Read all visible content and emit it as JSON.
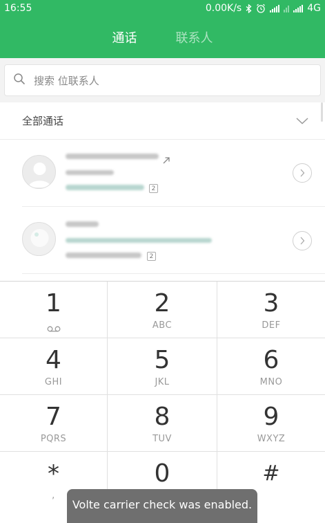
{
  "status_bar": {
    "time": "16:55",
    "network_speed": "0.00K/s",
    "network_type": "4G",
    "icons": [
      "bluetooth-icon",
      "alarm-icon",
      "signal-icon",
      "signal-icon",
      "signal-icon"
    ]
  },
  "tabs": [
    {
      "label": "通话",
      "active": true
    },
    {
      "label": "联系人",
      "active": false
    }
  ],
  "search": {
    "placeholder": "搜索   位联系人"
  },
  "section": {
    "title": "全部通话"
  },
  "calls": [
    {
      "count": "2",
      "call_direction_icon": "outgoing-arrow-icon"
    },
    {
      "count": "2"
    }
  ],
  "dialpad": {
    "keys": [
      {
        "digit": "1",
        "letters": "",
        "icon": "voicemail-icon"
      },
      {
        "digit": "2",
        "letters": "ABC"
      },
      {
        "digit": "3",
        "letters": "DEF"
      },
      {
        "digit": "4",
        "letters": "GHI"
      },
      {
        "digit": "5",
        "letters": "JKL"
      },
      {
        "digit": "6",
        "letters": "MNO"
      },
      {
        "digit": "7",
        "letters": "PQRS"
      },
      {
        "digit": "8",
        "letters": "TUV"
      },
      {
        "digit": "9",
        "letters": "WXYZ"
      },
      {
        "digit": "*",
        "letters": ","
      },
      {
        "digit": "0",
        "letters": "+"
      },
      {
        "digit": "#",
        "letters": ""
      }
    ]
  },
  "toast": {
    "message": "Volte carrier check was enabled."
  },
  "colors": {
    "brand_green": "#31b964",
    "toast_bg": "#6f6f6f"
  }
}
